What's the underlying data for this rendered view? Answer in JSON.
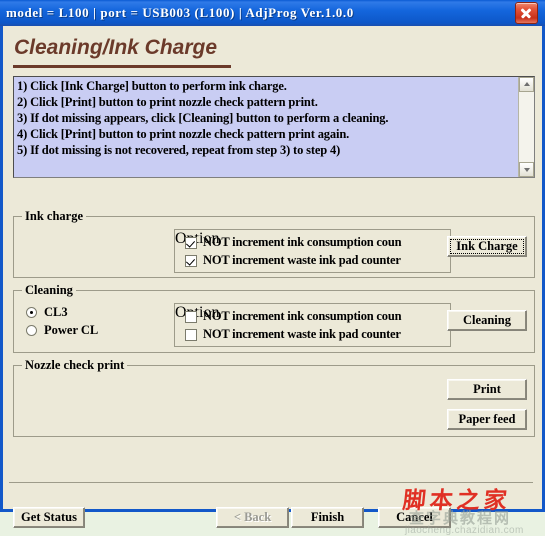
{
  "window": {
    "title": "model = L100  |  port = USB003  (L100)  |  AdjProg Ver.1.0.0",
    "close_label": "close-icon",
    "titlebar_color": "#1466dd",
    "client_color": "#ece9d8"
  },
  "page": {
    "heading": "Cleaning/Ink Charge"
  },
  "instructions": {
    "lines": [
      "1) Click [Ink Charge] button to perform ink charge.",
      "2) Click [Print] button to print nozzle check pattern print.",
      "3) If dot missing appears, click [Cleaning] button to perform a cleaning.",
      "4) Click [Print] button to print nozzle check pattern print again.",
      "5) If dot missing is not recovered, repeat from step 3) to step 4)"
    ],
    "background_color": "#c9cdf3"
  },
  "ink_charge": {
    "group_label": "Ink charge",
    "option_label": "Option",
    "options": [
      {
        "label": "NOT increment ink consumption coun",
        "checked": true
      },
      {
        "label": "NOT increment waste ink pad counter",
        "checked": true
      }
    ],
    "button_label": "Ink Charge",
    "button_focused": true
  },
  "cleaning": {
    "group_label": "Cleaning",
    "modes": [
      {
        "label": "CL3",
        "selected": true
      },
      {
        "label": "Power CL",
        "selected": false
      }
    ],
    "option_label": "Option",
    "options": [
      {
        "label": "NOT increment ink consumption coun",
        "checked": false
      },
      {
        "label": "NOT increment waste ink pad counter",
        "checked": false
      }
    ],
    "button_label": "Cleaning"
  },
  "nozzle_check": {
    "group_label": "Nozzle check print",
    "print_label": "Print",
    "paper_feed_label": "Paper feed"
  },
  "footer": {
    "get_status_label": "Get Status",
    "back_label": "< Back",
    "back_disabled": true,
    "finish_label": "Finish",
    "cancel_label": "Cancel"
  },
  "watermark": {
    "main": "脚本之家",
    "sub": "查字典教程网",
    "url": "jiaocheng.chazidian.com",
    "color": "#e03024"
  }
}
